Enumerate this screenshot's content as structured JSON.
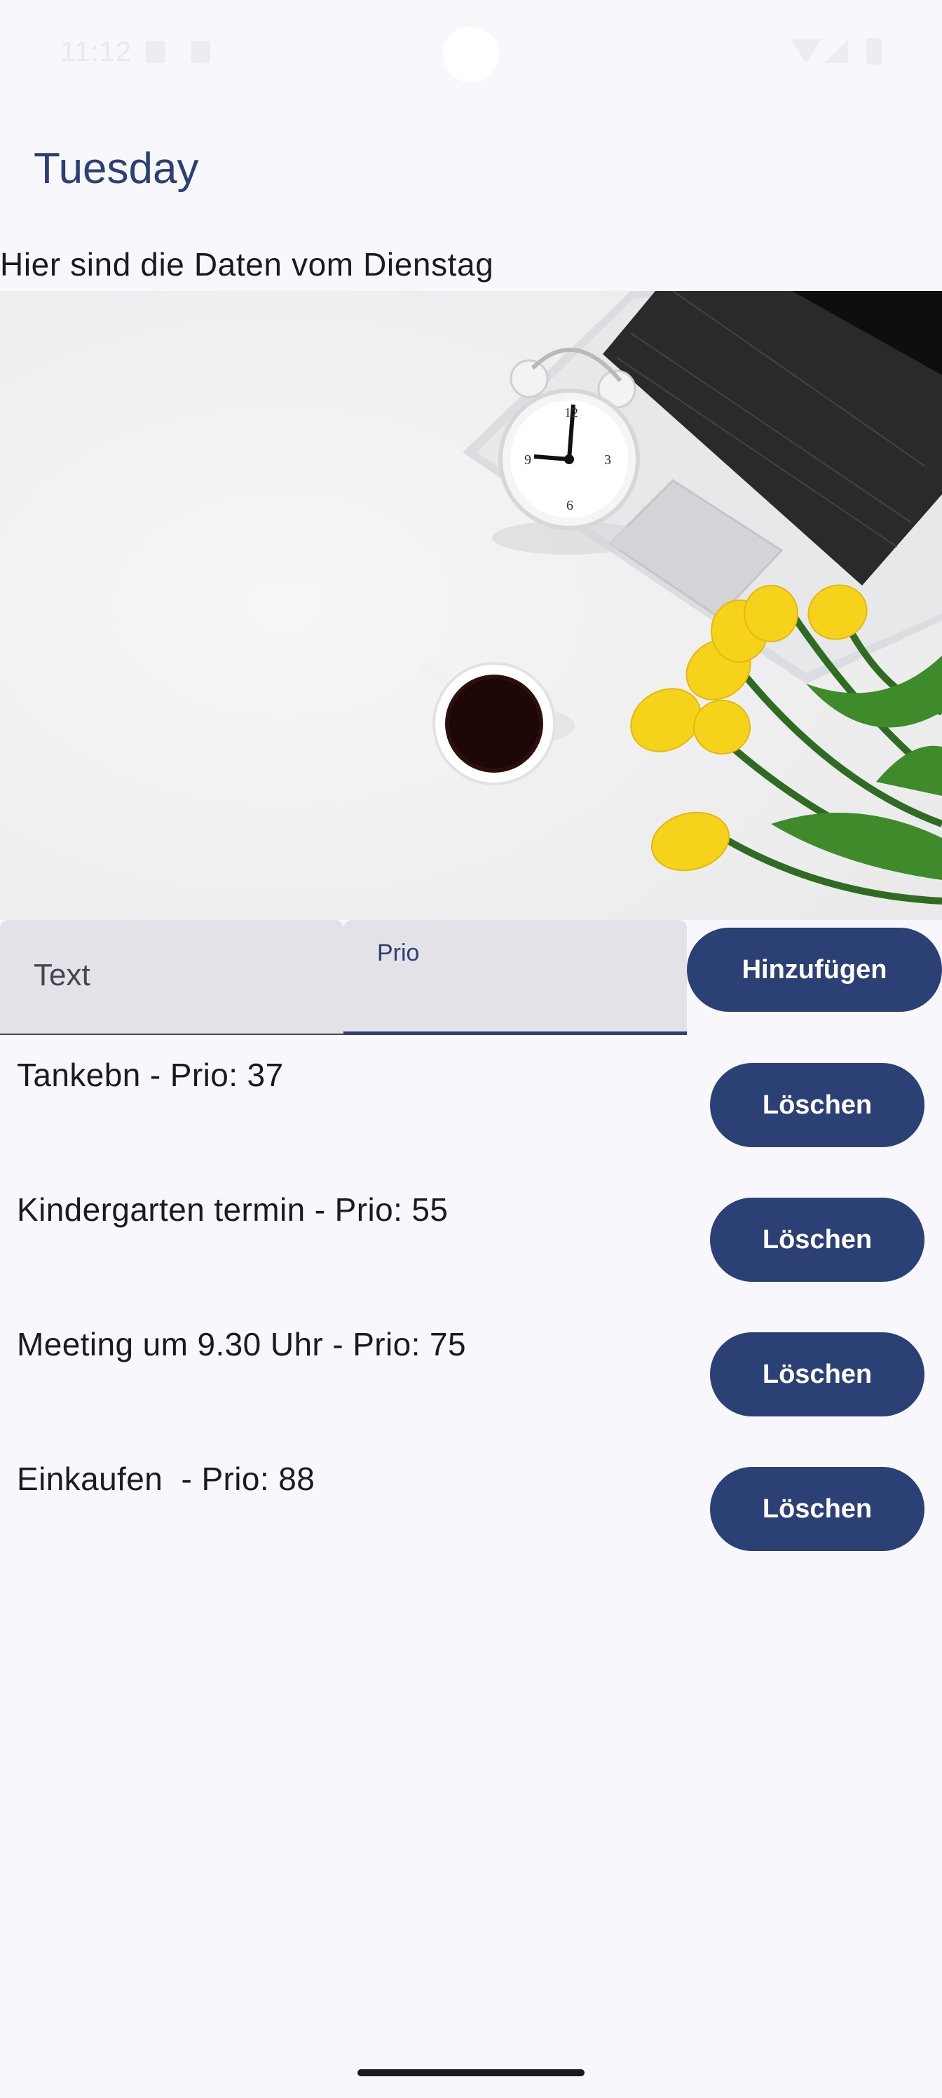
{
  "status_bar": {
    "time": "11:12"
  },
  "app": {
    "title": "Tuesday"
  },
  "subtitle": "Hier sind die Daten vom Dienstag",
  "hero_image": {
    "description_icon": "desk-photo"
  },
  "form": {
    "text_placeholder": "Text",
    "prio_label": "Prio",
    "add_label": "Hinzufügen"
  },
  "items": [
    {
      "text": "Tankebn - Prio: 37",
      "delete_label": "Löschen"
    },
    {
      "text": "Kindergarten termin - Prio: 55",
      "delete_label": "Löschen"
    },
    {
      "text": "Meeting um 9.30 Uhr - Prio: 75",
      "delete_label": "Löschen"
    },
    {
      "text": "Einkaufen  - Prio: 88",
      "delete_label": "Löschen"
    }
  ],
  "colors": {
    "primary": "#2b4175",
    "background": "#f8f7fc",
    "field": "#e3e2e8"
  }
}
